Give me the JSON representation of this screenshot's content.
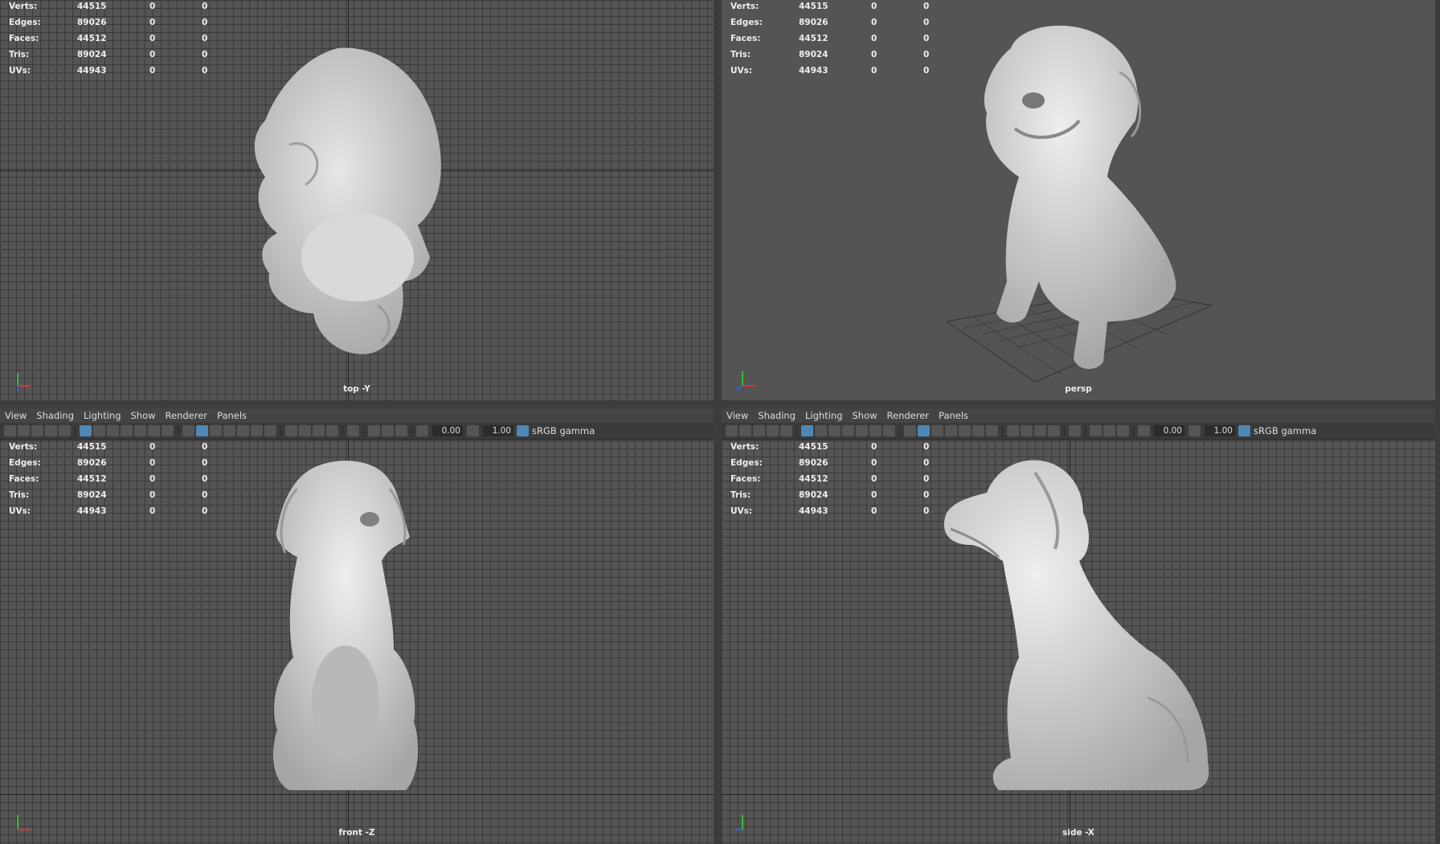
{
  "menu": [
    "View",
    "Shading",
    "Lighting",
    "Show",
    "Renderer",
    "Panels"
  ],
  "toolbar": {
    "exposure": "0.00",
    "gamma_value": "1.00",
    "colorspace": "sRGB gamma"
  },
  "stats": [
    {
      "label": "Verts:",
      "v1": "44515",
      "v2": "0",
      "v3": "0"
    },
    {
      "label": "Edges:",
      "v1": "89026",
      "v2": "0",
      "v3": "0"
    },
    {
      "label": "Faces:",
      "v1": "44512",
      "v2": "0",
      "v3": "0"
    },
    {
      "label": "Tris:",
      "v1": "89024",
      "v2": "0",
      "v3": "0"
    },
    {
      "label": "UVs:",
      "v1": "44943",
      "v2": "0",
      "v3": "0"
    }
  ],
  "panels": {
    "top": {
      "caption": "top -Y"
    },
    "persp": {
      "caption": "persp"
    },
    "front": {
      "caption": "front -Z"
    },
    "side": {
      "caption": "side -X"
    }
  },
  "axis_labels": {
    "x": "x",
    "y": "y",
    "z": "z"
  },
  "colors": {
    "axis_x": "#e03030",
    "axis_y": "#30c030",
    "axis_z": "#3060e0",
    "accent": "#4f88b6",
    "model": "#c9c9c9"
  }
}
